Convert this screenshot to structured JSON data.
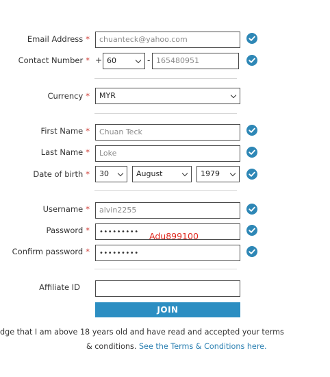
{
  "form": {
    "email": {
      "label": "Email Address",
      "required": "*",
      "value": "chuanteck@yahoo.com"
    },
    "contact": {
      "label": "Contact Number",
      "required": "*",
      "plus": "+",
      "country_code": "60",
      "separator": "-",
      "value": "165480951"
    },
    "currency": {
      "label": "Currency",
      "required": "*",
      "value": "MYR"
    },
    "first_name": {
      "label": "First Name",
      "required": "*",
      "value": "Chuan Teck"
    },
    "last_name": {
      "label": "Last Name",
      "required": "*",
      "value": "Loke"
    },
    "dob": {
      "label": "Date of birth",
      "required": "*",
      "day": "30",
      "month": "August",
      "year": "1979"
    },
    "username": {
      "label": "Username",
      "required": "*",
      "value": "alvin2255"
    },
    "password": {
      "label": "Password",
      "required": "*",
      "masked": "•••••••••"
    },
    "confirm_password": {
      "label": "Confirm password",
      "required": "*",
      "masked": "•••••••••"
    },
    "affiliate": {
      "label": "Affiliate ID",
      "value": ""
    },
    "join_label": "JOIN"
  },
  "overlay_text": "Adu899100",
  "terms": {
    "line1": "dge that I am above 18 years old and have read and accepted your terms",
    "line2_prefix": "& conditions. ",
    "link": "See the Terms & Conditions here."
  },
  "colors": {
    "accent": "#2c8ec2",
    "check": "#2e87b6",
    "required": "#cf3b34",
    "overlay": "#e0281e"
  },
  "icons": {
    "valid": "check-circle-icon",
    "dropdown": "chevron-down-icon"
  }
}
